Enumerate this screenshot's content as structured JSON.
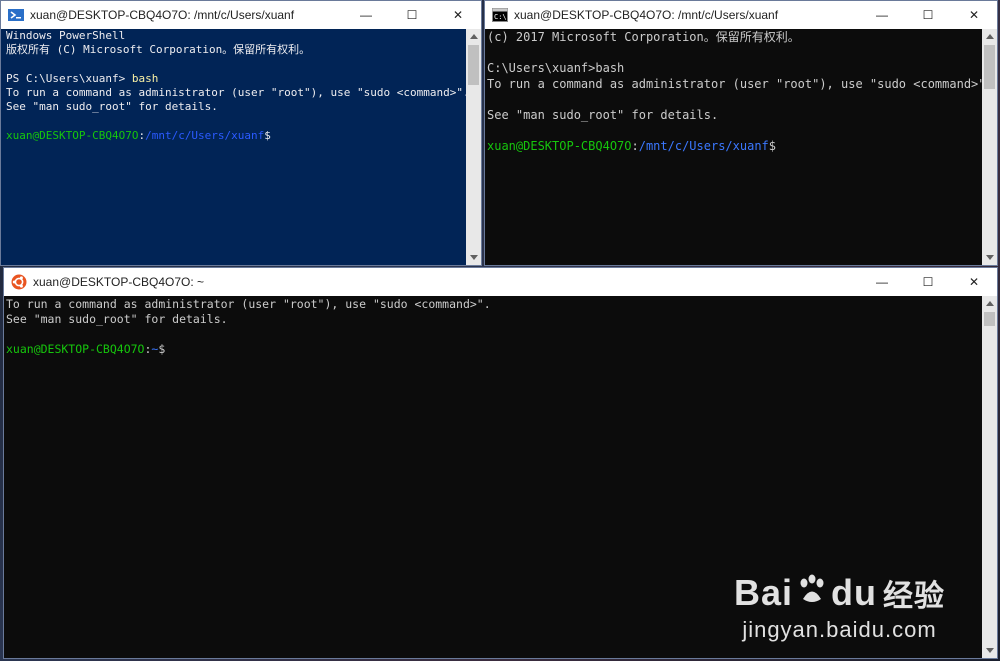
{
  "windows": {
    "powershell": {
      "title": "xuan@DESKTOP-CBQ4O7O: /mnt/c/Users/xuanf",
      "lines": {
        "l1": "Windows PowerShell",
        "l2": "版权所有 (C) Microsoft Corporation。保留所有权利。",
        "l4_prompt": "PS C:\\Users\\xuanf> ",
        "l4_cmd": "bash",
        "l5": "To run a command as administrator (user \"root\"), use \"sudo <command>\".",
        "l6": "See \"man sudo_root\" for details.",
        "p_user": "xuan@DESKTOP-CBQ4O7O",
        "p_sep": ":",
        "p_path": "/mnt/c/Users/xuanf",
        "p_end": "$"
      }
    },
    "cmd": {
      "title": "xuan@DESKTOP-CBQ4O7O: /mnt/c/Users/xuanf",
      "lines": {
        "l1": "(c) 2017 Microsoft Corporation。保留所有权利。",
        "l3": "C:\\Users\\xuanf>bash",
        "l4": "To run a command as administrator (user \"root\"), use \"sudo <command>\".",
        "l6": "See \"man sudo_root\" for details.",
        "p_user": "xuan@DESKTOP-CBQ4O7O",
        "p_sep": ":",
        "p_path": "/mnt/c/Users/xuanf",
        "p_end": "$"
      }
    },
    "ubuntu": {
      "title": "xuan@DESKTOP-CBQ4O7O: ~",
      "lines": {
        "l1": "To run a command as administrator (user \"root\"), use \"sudo <command>\".",
        "l2": "See \"man sudo_root\" for details.",
        "p_user": "xuan@DESKTOP-CBQ4O7O",
        "p_sep": ":",
        "p_path": "~",
        "p_end": "$"
      }
    }
  },
  "controls": {
    "minimize": "—",
    "maximize": "☐",
    "close": "✕"
  },
  "watermark": {
    "logo_left": "Bai",
    "logo_right": "du",
    "logo_cn": "经验",
    "sub": "jingyan.baidu.com"
  },
  "colors": {
    "ps_bg": "#012456",
    "console_bg": "#0c0c0c",
    "prompt_green": "#16c60c",
    "path_blue": "#3b78ff"
  }
}
